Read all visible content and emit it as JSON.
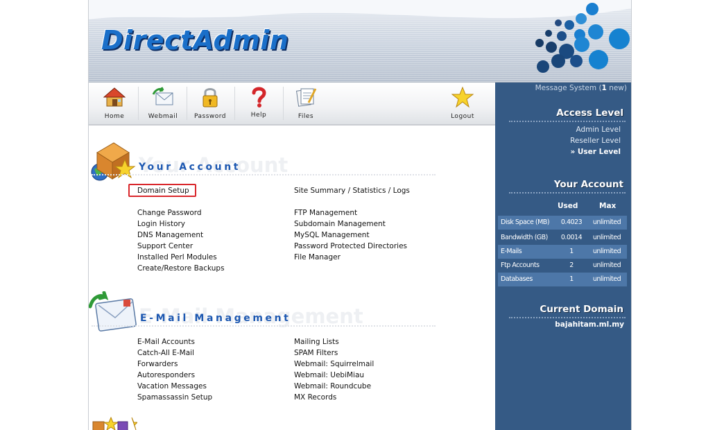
{
  "header": {
    "logo": "DirectAdmin"
  },
  "toolbar": {
    "items": [
      {
        "label": "Home",
        "icon": "home-icon"
      },
      {
        "label": "Webmail",
        "icon": "webmail-icon"
      },
      {
        "label": "Password",
        "icon": "padlock-icon"
      },
      {
        "label": "Help",
        "icon": "question-icon"
      },
      {
        "label": "Files",
        "icon": "files-icon"
      },
      {
        "label": "Logout",
        "icon": "star-icon"
      }
    ]
  },
  "sidebar": {
    "message_prefix": "Message System (",
    "message_count": "1",
    "message_suffix": " new)",
    "access_title": "Access Level",
    "levels": [
      "Admin Level",
      "Reseller Level",
      "» User Level"
    ],
    "account_title": "Your Account",
    "col_used": "Used",
    "col_max": "Max",
    "stats": [
      {
        "name": "Disk Space (MB)",
        "used": "0.4023",
        "max": "unlimited"
      },
      {
        "name": "Bandwidth (GB)",
        "used": "0.0014",
        "max": "unlimited"
      },
      {
        "name": "E-Mails",
        "used": "1",
        "max": "unlimited"
      },
      {
        "name": "Ftp Accounts",
        "used": "2",
        "max": "unlimited"
      },
      {
        "name": "Databases",
        "used": "1",
        "max": "unlimited"
      }
    ],
    "domain_title": "Current Domain",
    "domain": "bajahitam.ml.my"
  },
  "account_section": {
    "title": "Your Account",
    "ghost": "Your Account",
    "left": [
      "Domain Setup",
      "Change Password",
      "Login History",
      "DNS Management",
      "Support Center",
      "Installed Perl Modules",
      "Create/Restore Backups"
    ],
    "right": [
      "Site Summary / Statistics / Logs",
      "FTP Management",
      "Subdomain Management",
      "MySQL Management",
      "Password Protected Directories",
      "File Manager"
    ]
  },
  "email_section": {
    "title": "E-Mail Management",
    "ghost": "E-Mail Management",
    "left": [
      "E-Mail Accounts",
      "Catch-All E-Mail",
      "Forwarders",
      "Autoresponders",
      "Vacation Messages",
      "Spamassassin Setup"
    ],
    "right": [
      "Mailing Lists",
      "SPAM Filters",
      "Webmail: Squirrelmail",
      "Webmail: UebiMiau",
      "Webmail: Roundcube",
      "MX Records"
    ]
  },
  "colors": {
    "accent": "#1d58b1",
    "sidebar": "#355a85",
    "highlight": "#d9262b"
  }
}
